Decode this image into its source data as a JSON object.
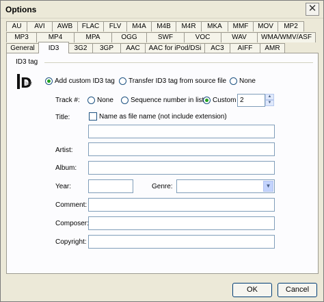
{
  "window": {
    "title": "Options",
    "close_glyph": "✕"
  },
  "tabs": {
    "row1": [
      "AU",
      "AVI",
      "AWB",
      "FLAC",
      "FLV",
      "M4A",
      "M4B",
      "M4R",
      "MKA",
      "MMF",
      "MOV",
      "MP2"
    ],
    "row2": [
      "MP3",
      "MP4",
      "MPA",
      "OGG",
      "SWF",
      "VOC",
      "WAV",
      "WMA/WMV/ASF"
    ],
    "row3": [
      "General",
      "ID3",
      "3G2",
      "3GP",
      "AAC",
      "AAC for iPod/DSi",
      "AC3",
      "AIFF",
      "AMR"
    ],
    "active": "ID3"
  },
  "id3": {
    "group_label": "ID3 tag",
    "logo_icon": "id3v2-logo-icon",
    "logo_letter": "D",
    "logo_sub": "3v2",
    "mode_options": {
      "add": "Add custom ID3 tag",
      "transfer": "Transfer ID3 tag from source file",
      "none": "None"
    },
    "mode_selected": "add",
    "track_label": "Track #:",
    "track_options": {
      "none": "None",
      "sequence": "Sequence number in list",
      "custom": "Custom"
    },
    "track_selected": "custom",
    "track_custom_value": "2",
    "title_label": "Title:",
    "name_as_file_label": "Name as file name (not include extension)",
    "name_as_file_checked": false,
    "title_value": "",
    "artist_label": "Artist:",
    "artist_value": "",
    "album_label": "Album:",
    "album_value": "",
    "year_label": "Year:",
    "year_value": "",
    "genre_label": "Genre:",
    "genre_value": "",
    "comment_label": "Comment:",
    "comment_value": "",
    "composer_label": "Composer:",
    "composer_value": "",
    "copyright_label": "Copyright:",
    "copyright_value": ""
  },
  "buttons": {
    "ok": "OK",
    "cancel": "Cancel"
  },
  "colors": {
    "radio_selected": "#21a121",
    "accent_border": "#7f9db9"
  }
}
